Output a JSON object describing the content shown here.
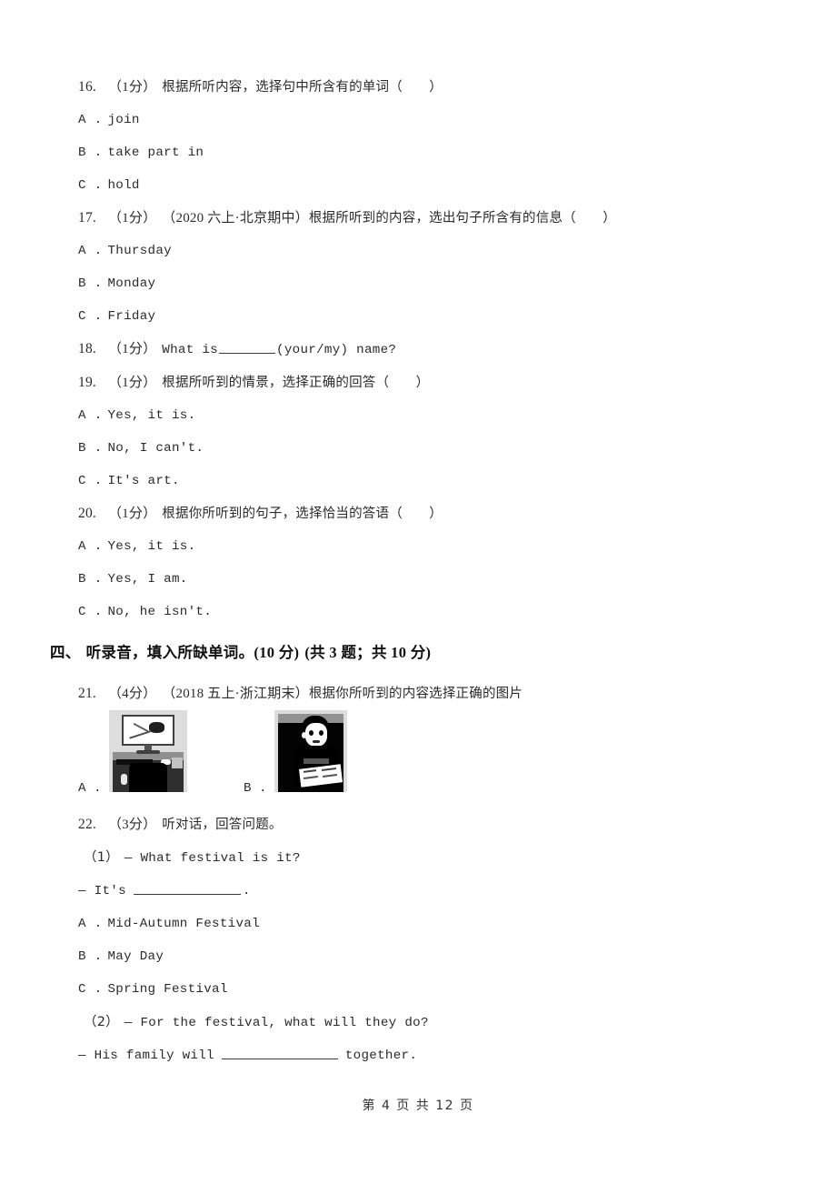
{
  "page": {
    "footer": "第 4 页 共 12 页",
    "page_number": "4",
    "total_pages": "12"
  },
  "questions": [
    {
      "number": "16.",
      "points": "（1分）",
      "source": "",
      "stem": "根据所听内容，选择句中所含有的单词（　　）",
      "options": [
        {
          "letter": "A .",
          "text": "join"
        },
        {
          "letter": "B .",
          "text": "take part in"
        },
        {
          "letter": "C .",
          "text": "hold"
        }
      ]
    },
    {
      "number": "17.",
      "points": "（1分）",
      "source": "（2020 六上·北京期中）",
      "stem": "根据所听到的内容，选出句子所含有的信息（　　）",
      "options": [
        {
          "letter": "A .",
          "text": "Thursday"
        },
        {
          "letter": "B .",
          "text": "Monday"
        },
        {
          "letter": "C .",
          "text": "Friday"
        }
      ]
    },
    {
      "number": "18.",
      "points": "（1分）",
      "source": "",
      "stem_pre": "What is",
      "stem_post": "(your/my) name?",
      "options": []
    },
    {
      "number": "19.",
      "points": "（1分）",
      "source": "",
      "stem": "根据所听到的情景，选择正确的回答（　　）",
      "options": [
        {
          "letter": "A .",
          "text": "Yes, it is."
        },
        {
          "letter": "B .",
          "text": "No, I can't."
        },
        {
          "letter": "C .",
          "text": "It's art."
        }
      ]
    },
    {
      "number": "20.",
      "points": "（1分）",
      "source": "",
      "stem": "根据你所听到的句子，选择恰当的答语（　　）",
      "options": [
        {
          "letter": "A .",
          "text": "Yes, it is."
        },
        {
          "letter": "B .",
          "text": "Yes, I am."
        },
        {
          "letter": "C .",
          "text": "No, he isn't."
        }
      ]
    }
  ],
  "section": {
    "index": "四、",
    "title": "听录音，填入所缺单词。",
    "points": "(10 分)",
    "count": "(共 3 题；共 10 分)"
  },
  "question21": {
    "number": "21.",
    "points": "（4分）",
    "source": "（2018 五上·浙江期末）",
    "stem": "根据你所听到的内容选择正确的图片",
    "choices": [
      {
        "letter": "A .",
        "image": "computer-desk-photo"
      },
      {
        "letter": "B .",
        "image": "boy-reading-newspaper-photo"
      }
    ]
  },
  "question22": {
    "number": "22.",
    "points": "（3分）",
    "stem": "听对话，回答问题。",
    "parts": [
      {
        "label": "（1）",
        "question": "— What festival is it?",
        "answer_pre": "— It's",
        "answer_post": ".",
        "options": [
          {
            "letter": "A .",
            "text": "Mid-Autumn Festival"
          },
          {
            "letter": "B .",
            "text": "May Day"
          },
          {
            "letter": "C .",
            "text": "Spring Festival"
          }
        ]
      },
      {
        "label": "（2）",
        "question": "— For the festival, what will they do?",
        "answer_pre": "— His family will",
        "answer_post": "together.",
        "options": []
      }
    ]
  }
}
